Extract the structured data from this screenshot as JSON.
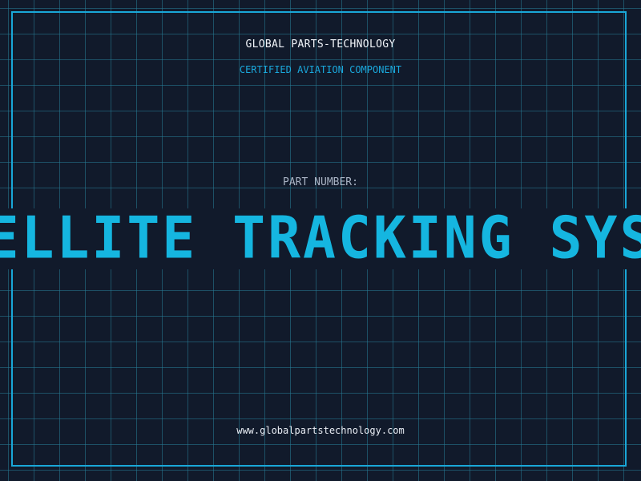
{
  "label": {
    "company": "GLOBAL PARTS-TECHNOLOGY",
    "tagline": "CERTIFIED AVIATION COMPONENT",
    "part_number_label": "PART NUMBER:",
    "part_number_value": "SATELLITE TRACKING SYSTEM",
    "website": "www.globalpartstechnology.com"
  },
  "colors": {
    "background": "#111a2b",
    "grid": "#267c96",
    "accent": "#19a7d8",
    "text_primary": "#f2f5fa",
    "text_muted": "#a9b3c4"
  }
}
